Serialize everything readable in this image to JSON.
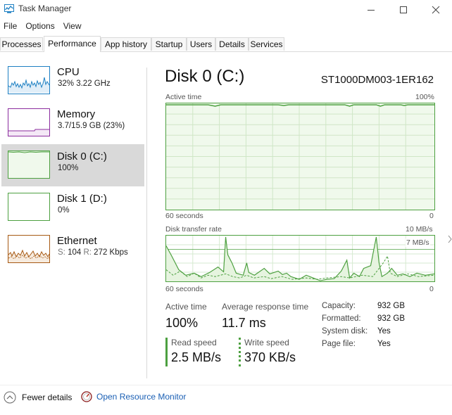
{
  "window": {
    "title": "Task Manager"
  },
  "menu": [
    "File",
    "Options",
    "View"
  ],
  "tabs": [
    "Processes",
    "Performance",
    "App history",
    "Startup",
    "Users",
    "Details",
    "Services"
  ],
  "sidebar": {
    "items": [
      {
        "name": "CPU",
        "sub": "32%  3.22 GHz",
        "color": "#1e80c3"
      },
      {
        "name": "Memory",
        "sub": "3.7/15.9 GB (23%)",
        "color": "#8b2c9e"
      },
      {
        "name": "Disk 0 (C:)",
        "sub": "100%",
        "color": "#4da040"
      },
      {
        "name": "Disk 1 (D:)",
        "sub": "0%",
        "color": "#4da040"
      },
      {
        "name": "Ethernet",
        "sub_prefix_s": "S:",
        "sub_s": "104",
        "sub_prefix_r": "R:",
        "sub_r": "272 Kbps",
        "color": "#a75a14"
      }
    ]
  },
  "main": {
    "title": "Disk 0 (C:)",
    "model": "ST1000DM003-1ER162",
    "active_chart": {
      "label": "Active time",
      "max": "100%",
      "time_left": "60 seconds",
      "time_right": "0",
      "level_pct": 100
    },
    "transfer_chart": {
      "label": "Disk transfer rate",
      "max": "10 MB/s",
      "inner_max": "7 MB/s",
      "time_left": "60 seconds",
      "time_right": "0"
    },
    "stats": {
      "active_time_label": "Active time",
      "active_time_value": "100%",
      "avg_response_label": "Average response time",
      "avg_response_value": "11.7 ms",
      "read_label": "Read speed",
      "read_value": "2.5 MB/s",
      "write_label": "Write speed",
      "write_value": "370 KB/s"
    },
    "properties": [
      {
        "label": "Capacity:",
        "value": "932 GB"
      },
      {
        "label": "Formatted:",
        "value": "932 GB"
      },
      {
        "label": "System disk:",
        "value": "Yes"
      },
      {
        "label": "Page file:",
        "value": "Yes"
      }
    ]
  },
  "footer": {
    "fewer_details": "Fewer details",
    "resource_monitor": "Open Resource Monitor"
  },
  "colors": {
    "disk_green": "#4da040",
    "disk_fill": "#f0f9ec",
    "cpu_blue": "#1e80c3",
    "memory_purple": "#8b2c9e",
    "ethernet_brown": "#a75a14",
    "link_blue": "#1a5fb4"
  }
}
